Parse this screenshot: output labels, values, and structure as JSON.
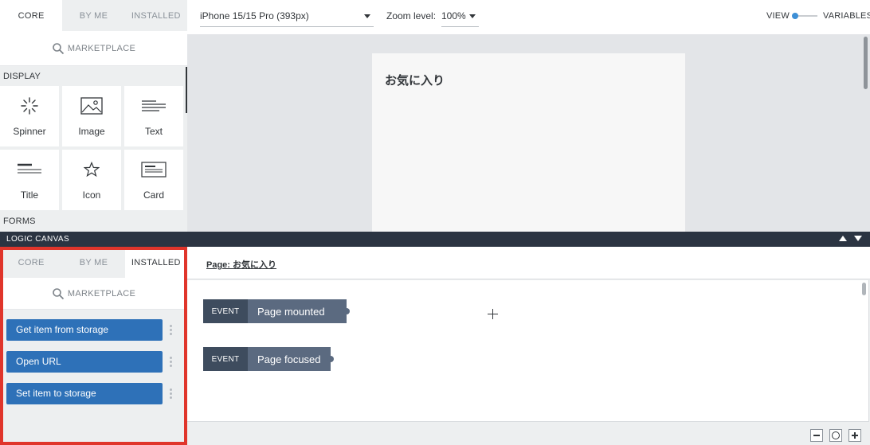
{
  "top_palette": {
    "tabs": [
      {
        "label": "CORE",
        "active": true
      },
      {
        "label": "BY ME",
        "active": false
      },
      {
        "label": "INSTALLED",
        "active": false
      }
    ],
    "marketplace_label": "MARKETPLACE",
    "sections": {
      "display": "DISPLAY",
      "forms": "FORMS"
    },
    "components": [
      {
        "label": "Spinner",
        "icon": "spinner-icon"
      },
      {
        "label": "Image",
        "icon": "image-icon"
      },
      {
        "label": "Text",
        "icon": "text-icon"
      },
      {
        "label": "Title",
        "icon": "title-icon"
      },
      {
        "label": "Icon",
        "icon": "star-icon"
      },
      {
        "label": "Card",
        "icon": "card-icon"
      }
    ]
  },
  "topbar": {
    "device": "iPhone 15/15 Pro (393px)",
    "zoom_label": "Zoom level:",
    "zoom_value": "100%",
    "view_label": "VIEW",
    "variables_label": "VARIABLES"
  },
  "canvas": {
    "page_title": "お気に入り"
  },
  "logic_canvas": {
    "header_label": "LOGIC CANVAS",
    "page_link": "Page: お気に入り",
    "events": [
      {
        "tag": "EVENT",
        "name": "Page mounted"
      },
      {
        "tag": "EVENT",
        "name": "Page focused"
      }
    ]
  },
  "bottom_palette": {
    "tabs": [
      {
        "label": "CORE",
        "active": false
      },
      {
        "label": "BY ME",
        "active": false
      },
      {
        "label": "INSTALLED",
        "active": true
      }
    ],
    "marketplace_label": "MARKETPLACE",
    "functions": [
      {
        "label": "Get item from storage"
      },
      {
        "label": "Open URL"
      },
      {
        "label": "Set item to storage"
      }
    ]
  },
  "colors": {
    "accent_blue": "#2e71b8",
    "highlight_red": "#e0352b",
    "header_dark": "#2b3442",
    "event_tag": "#3e4c5e",
    "event_name": "#5b6a80"
  }
}
